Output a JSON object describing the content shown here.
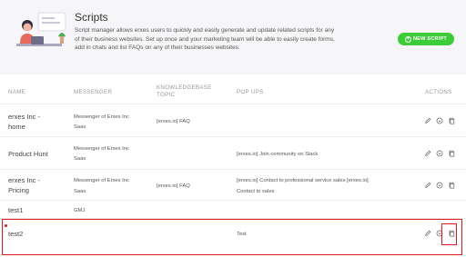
{
  "header": {
    "title": "Scripts",
    "description": "Script manager allows erxes users to quickly and easily generate and update related scripts for any of their business websites. Set up once and your marketing team will be able to easily create forms, add in chats and list FAQs on any of their businesses websites.",
    "new_button": "NEW SCRIPT"
  },
  "table": {
    "columns": {
      "name": "NAME",
      "messenger": "MESSENGER",
      "kb_line1": "KNOWLEDGEBASE",
      "kb_line2": "TOPIC",
      "popups": "POP UPS",
      "actions": "ACTIONS"
    },
    "rows": [
      {
        "name1": "erxes Inc -",
        "name2": "home",
        "messenger1": "Messenger of Erxes Inc",
        "messenger2": "Saas",
        "kb": "[erxes.io] FAQ",
        "popups1": "",
        "popups2": ""
      },
      {
        "name1": "Product Hunt",
        "name2": "",
        "messenger1": "Messenger of Erxes Inc",
        "messenger2": "Saas",
        "kb": "",
        "popups1": "[erxes.io] Join community on Slack",
        "popups2": ""
      },
      {
        "name1": "erxes Inc -",
        "name2": "Pricing",
        "messenger1": "Messenger of Erxes Inc",
        "messenger2": "Saas",
        "kb": "[erxes.io] FAQ",
        "popups1": "[erxes.io] Contact to professional service sales [erxes.io]",
        "popups2": "Contact to sales"
      },
      {
        "name1": "test1",
        "name2": "",
        "messenger1": "GMJ",
        "messenger2": "",
        "kb": "",
        "popups1": "",
        "popups2": ""
      },
      {
        "name1": "test2",
        "name2": "",
        "messenger1": "",
        "messenger2": "",
        "kb": "",
        "popups1": "Test",
        "popups2": ""
      }
    ]
  },
  "icons": {
    "edit": "pencil-icon",
    "install": "install-code-icon",
    "copy": "copy-icon"
  },
  "colors": {
    "accent": "#3ccc38",
    "highlight": "#e2181f"
  }
}
